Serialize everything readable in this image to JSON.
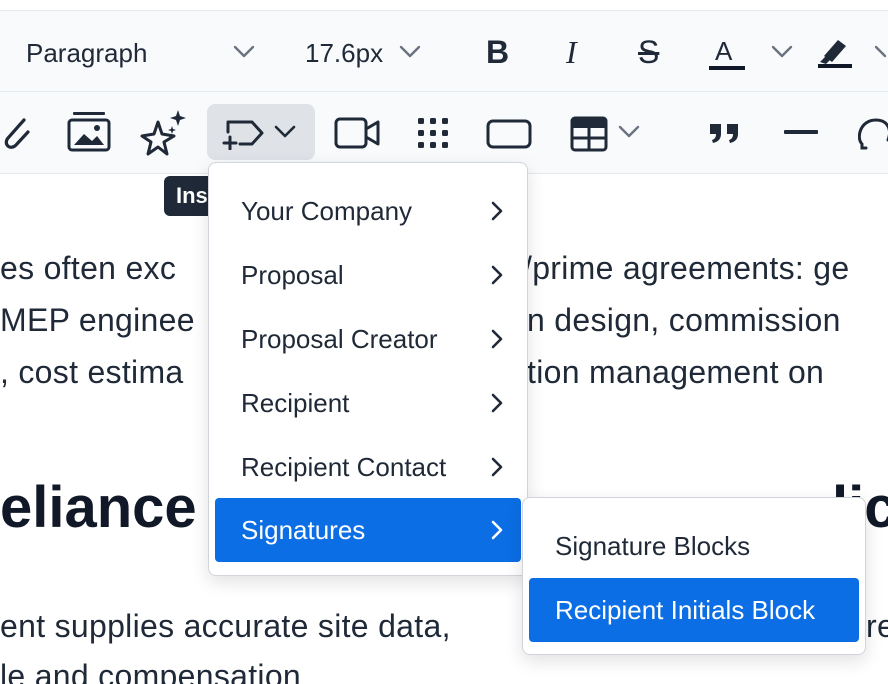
{
  "toolbar": {
    "paragraph_style": "Paragraph",
    "font_size": "17.6px",
    "bold_label": "B",
    "italic_label": "I",
    "strike_label": "S",
    "text_color_label": "A",
    "colors": {
      "text_color_bar": "#111827",
      "highlight_bar": "#111827"
    }
  },
  "toolbar2": {
    "icons": [
      "attachment-icon",
      "image-gallery-icon",
      "ai-sparkle-icon",
      "insert-field-icon",
      "video-icon",
      "grid-icon",
      "button-block-icon",
      "table-icon",
      "quote-icon",
      "horizontal-rule-icon",
      "omega-icon"
    ]
  },
  "tooltip": {
    "text": "Ins"
  },
  "content": {
    "line1_left": "es often exc",
    "line1_right": "/prime agreements: ge",
    "line2_left": "MEP enginee",
    "line2_right": "n design, commission",
    "line3_left": ", cost estima",
    "line3_right": "tion management on",
    "heading_left": "eliance",
    "heading_right": "lic",
    "line4_left": "ent supplies accurate site data,",
    "line4_right": "re",
    "line5": "le and compensation"
  },
  "menu": {
    "items": [
      {
        "label": "Your Company",
        "has_submenu": true
      },
      {
        "label": "Proposal",
        "has_submenu": true
      },
      {
        "label": "Proposal Creator",
        "has_submenu": true
      },
      {
        "label": "Recipient",
        "has_submenu": true
      },
      {
        "label": "Recipient Contact",
        "has_submenu": true
      },
      {
        "label": "Signatures",
        "has_submenu": true,
        "active": true
      }
    ],
    "submenu": [
      {
        "label": "Signature Blocks"
      },
      {
        "label": "Recipient Initials Block",
        "active": true
      }
    ],
    "colors": {
      "active_bg": "#0b6ee5",
      "active_text": "#ffffff"
    }
  }
}
